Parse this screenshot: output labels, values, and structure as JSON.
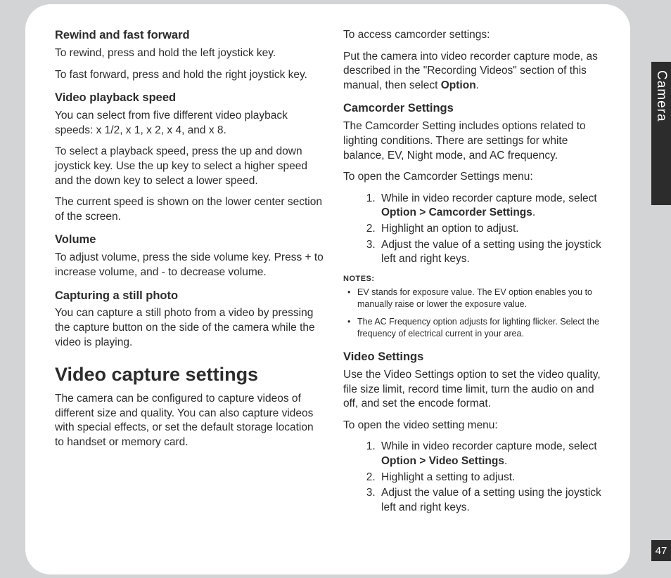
{
  "sideTab": "Camera",
  "pageNumber": "47",
  "left": {
    "rewind": {
      "heading": "Rewind and fast forward",
      "p1": "To rewind, press and hold the left joystick key.",
      "p2": "To fast forward, press and hold the right joystick key."
    },
    "speed": {
      "heading": "Video playback speed",
      "p1": "You can select from five different video playback speeds: x 1/2, x 1, x 2,  x 4, and x 8.",
      "p2": "To select a playback speed, press the up and down joystick key. Use the up key to select a higher speed and the down key to select a lower speed.",
      "p3": "The current speed is shown on the lower center section of the screen."
    },
    "volume": {
      "heading": "Volume",
      "p1": "To adjust volume, press the side volume key. Press + to increase volume, and - to decrease volume."
    },
    "still": {
      "heading": "Capturing a still photo",
      "p1": "You can capture a still photo from a video by pressing the capture button on the side of the camera while the video is playing."
    },
    "vcs": {
      "heading": "Video capture settings",
      "p1": "The camera can be configured to capture videos of different size and quality. You can also capture videos with special effects, or set the default storage location to handset or memory card."
    }
  },
  "right": {
    "access": {
      "p1": "To access camcorder settings:",
      "p2a": "Put the camera into video recorder capture mode, as described in the \"Recording Videos\" section of this manual, then select ",
      "p2b": "Option",
      "p2c": "."
    },
    "cam": {
      "heading": "Camcorder Settings",
      "p1": "The Camcorder Setting includes options related to lighting conditions. There are settings for white balance, EV, Night mode, and AC frequency.",
      "p2": "To open the Camcorder Settings menu:",
      "li1a": "While in video recorder capture mode, select ",
      "li1b": "Option > Camcorder Settings",
      "li1c": ".",
      "li2": "Highlight an option to adjust.",
      "li3": "Adjust the value of a setting using the joystick left and right keys.",
      "notesLabel": "NOTES:",
      "n1": "EV stands for exposure value. The EV option enables you to manually raise or lower the exposure value.",
      "n2": "The AC Frequency option adjusts for lighting flicker. Select the frequency of electrical current in your area."
    },
    "vid": {
      "heading": "Video Settings",
      "p1": "Use the Video Settings option to set the video quality, file size limit, record time limit, turn the audio on and off, and set the encode format.",
      "p2": "To open the video setting menu:",
      "li1a": "While in video recorder capture mode, select ",
      "li1b": "Option > Video Settings",
      "li1c": ".",
      "li2": "Highlight a setting to adjust.",
      "li3": "Adjust the value of a setting using the joystick left and right keys."
    }
  }
}
